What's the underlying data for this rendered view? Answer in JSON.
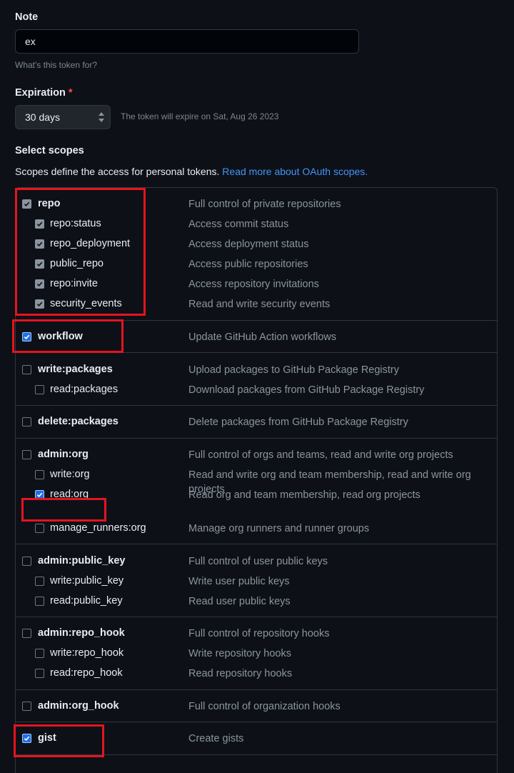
{
  "note": {
    "label": "Note",
    "value": "ex",
    "hint": "What's this token for?"
  },
  "expiration": {
    "label": "Expiration",
    "required_mark": "*",
    "selected": "30 days",
    "hint": "The token will expire on Sat, Aug 26 2023"
  },
  "scopes": {
    "heading": "Select scopes",
    "description": "Scopes define the access for personal tokens.",
    "link": "Read more about OAuth scopes.",
    "groups": [
      {
        "name": "repo",
        "desc": "Full control of private repositories",
        "checked": true,
        "children": [
          {
            "name": "repo:status",
            "desc": "Access commit status",
            "checked": true
          },
          {
            "name": "repo_deployment",
            "desc": "Access deployment status",
            "checked": true
          },
          {
            "name": "public_repo",
            "desc": "Access public repositories",
            "checked": true
          },
          {
            "name": "repo:invite",
            "desc": "Access repository invitations",
            "checked": true
          },
          {
            "name": "security_events",
            "desc": "Read and write security events",
            "checked": true
          }
        ]
      },
      {
        "name": "workflow",
        "desc": "Update GitHub Action workflows",
        "checked": true,
        "children": []
      },
      {
        "name": "write:packages",
        "desc": "Upload packages to GitHub Package Registry",
        "checked": false,
        "children": [
          {
            "name": "read:packages",
            "desc": "Download packages from GitHub Package Registry",
            "checked": false
          }
        ]
      },
      {
        "name": "delete:packages",
        "desc": "Delete packages from GitHub Package Registry",
        "checked": false,
        "children": []
      },
      {
        "name": "admin:org",
        "desc": "Full control of orgs and teams, read and write org projects",
        "checked": false,
        "children": [
          {
            "name": "write:org",
            "desc": "Read and write org and team membership, read and write org projects",
            "checked": false
          },
          {
            "name": "read:org",
            "desc": "Read org and team membership, read org projects",
            "checked": true
          },
          {
            "name": "manage_runners:org",
            "desc": "Manage org runners and runner groups",
            "checked": false
          }
        ]
      },
      {
        "name": "admin:public_key",
        "desc": "Full control of user public keys",
        "checked": false,
        "children": [
          {
            "name": "write:public_key",
            "desc": "Write user public keys",
            "checked": false
          },
          {
            "name": "read:public_key",
            "desc": "Read user public keys",
            "checked": false
          }
        ]
      },
      {
        "name": "admin:repo_hook",
        "desc": "Full control of repository hooks",
        "checked": false,
        "children": [
          {
            "name": "write:repo_hook",
            "desc": "Write repository hooks",
            "checked": false
          },
          {
            "name": "read:repo_hook",
            "desc": "Read repository hooks",
            "checked": false
          }
        ]
      },
      {
        "name": "admin:org_hook",
        "desc": "Full control of organization hooks",
        "checked": false,
        "children": []
      },
      {
        "name": "gist",
        "desc": "Create gists",
        "checked": true,
        "children": []
      }
    ]
  },
  "colors": {
    "background": "#0d1117",
    "border": "#30363d",
    "muted_text": "#8b949e",
    "link": "#4493f8",
    "highlight_box": "#e5141f",
    "checkbox_blue": "#1f6feb"
  }
}
